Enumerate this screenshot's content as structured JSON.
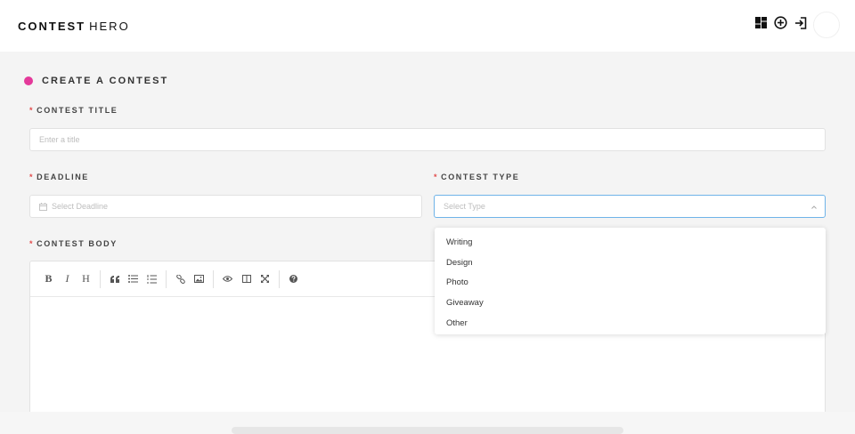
{
  "header": {
    "brand_bold": "CONTEST",
    "brand_light": "HERO",
    "icons": [
      "dashboard-icon",
      "add-circle-icon",
      "sign-in-icon"
    ]
  },
  "form": {
    "section_title": "CREATE A CONTEST",
    "required_mark": "*",
    "title_label": "CONTEST TITLE",
    "title_placeholder": "Enter a title",
    "deadline_label": "DEADLINE",
    "deadline_placeholder": "Select Deadline",
    "type_label": "CONTEST TYPE",
    "type_placeholder": "Select Type",
    "body_label": "CONTEST BODY",
    "type_options": [
      "Writing",
      "Design",
      "Photo",
      "Giveaway",
      "Other"
    ]
  },
  "editor": {
    "toolbar": {
      "bold": "B",
      "italic": "I",
      "heading": "H"
    }
  },
  "colors": {
    "accent_dot": "#e4399a",
    "required": "#e24b4b",
    "focus_border": "#6fb3e8"
  }
}
